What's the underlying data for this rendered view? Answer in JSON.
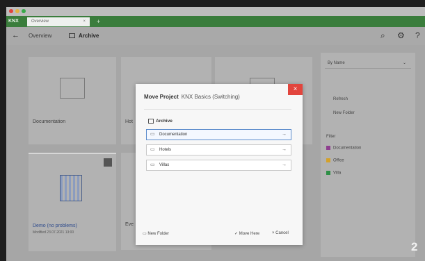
{
  "tab": {
    "title": "Overview",
    "close": "×",
    "new": "+"
  },
  "app": {
    "logo": "KNX"
  },
  "toolbar": {
    "back": "←",
    "overview": "Overview",
    "archive": "Archive",
    "search": "⌕",
    "settings": "⚙",
    "help": "?"
  },
  "cards": [
    {
      "label": "Documentation"
    },
    {
      "label": "Hot"
    },
    {
      "label": "Demo (no problems)",
      "sub": "Modified 23.07.2021 13:00"
    },
    {
      "label": "Eve"
    }
  ],
  "side": {
    "sort": "By Name",
    "refresh": "Refresh",
    "new_folder": "New Folder",
    "filter_title": "Filter",
    "filters": [
      {
        "label": "Documentation",
        "color": "#8e3e8f"
      },
      {
        "label": "Office",
        "color": "#d4a12a"
      },
      {
        "label": "Villa",
        "color": "#2e8f46"
      }
    ]
  },
  "dialog": {
    "title": "Move Project",
    "subtitle": "KNX Basics (Switching)",
    "close": "×",
    "crumb": "Archive",
    "folders": [
      {
        "label": "Documentation",
        "selected": true
      },
      {
        "label": "Hotels",
        "selected": false
      },
      {
        "label": "Villas",
        "selected": false
      }
    ],
    "new_folder": "New Folder",
    "move_here": "Move Here",
    "cancel": "Cancel"
  },
  "step": "2"
}
